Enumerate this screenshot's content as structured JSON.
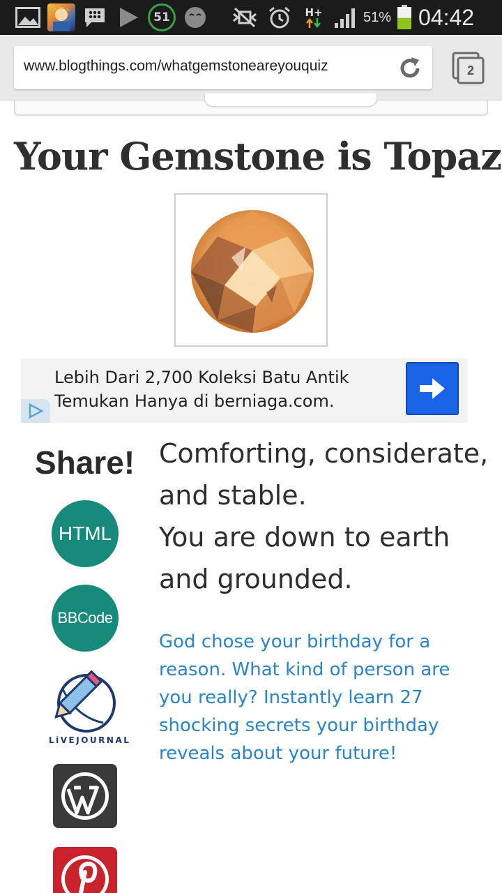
{
  "status_bar": {
    "icons": [
      "gallery-icon",
      "app-avatar-icon",
      "bbm-icon",
      "play-store-icon",
      "notification-count-icon",
      "smiley-icon",
      "mute-icon",
      "alarm-icon",
      "network-hplus-icon",
      "signal-icon",
      "battery-icon"
    ],
    "notification_count": "51",
    "network_type": "H+",
    "battery_percent": "51%",
    "battery_level": 0.51,
    "time": "04:42",
    "colors": {
      "badge_ring": "#37a245",
      "battery_fill": "#8dc21f"
    }
  },
  "browser": {
    "url": "www.blogthings.com/whatgemstoneareyouquiz",
    "tab_count": "2",
    "icons": [
      "reload-icon",
      "tabs-icon"
    ]
  },
  "page": {
    "title": "Your Gemstone is Topaz",
    "gem_image": "topaz-gem-image",
    "ad": {
      "line1": "Lebih Dari 2,700 Koleksi Batu Antik",
      "line2": "Temukan Hanya di berniaga.com.",
      "button_icon": "arrow-right-icon",
      "choice_icon": "ad-choices-icon",
      "button_color": "#1a64e8"
    },
    "share": {
      "title": "Share!",
      "html_label": "HTML",
      "bbcode_label": "BBCode",
      "livejournal_label": "LiVEJOURNAL",
      "icons": [
        "livejournal-icon",
        "wordpress-icon",
        "pinterest-icon"
      ],
      "circle_color": "#178a7b"
    },
    "description": {
      "line1": "Comforting, considerate,",
      "line2": "and stable.",
      "line3": "You are down to earth",
      "line4": "and grounded."
    },
    "promo": "God chose your birthday for a reason. What kind of person are you really? Instantly learn 27 shocking secrets your birthday reveals about your future!",
    "promo_color": "#2a85c8"
  }
}
